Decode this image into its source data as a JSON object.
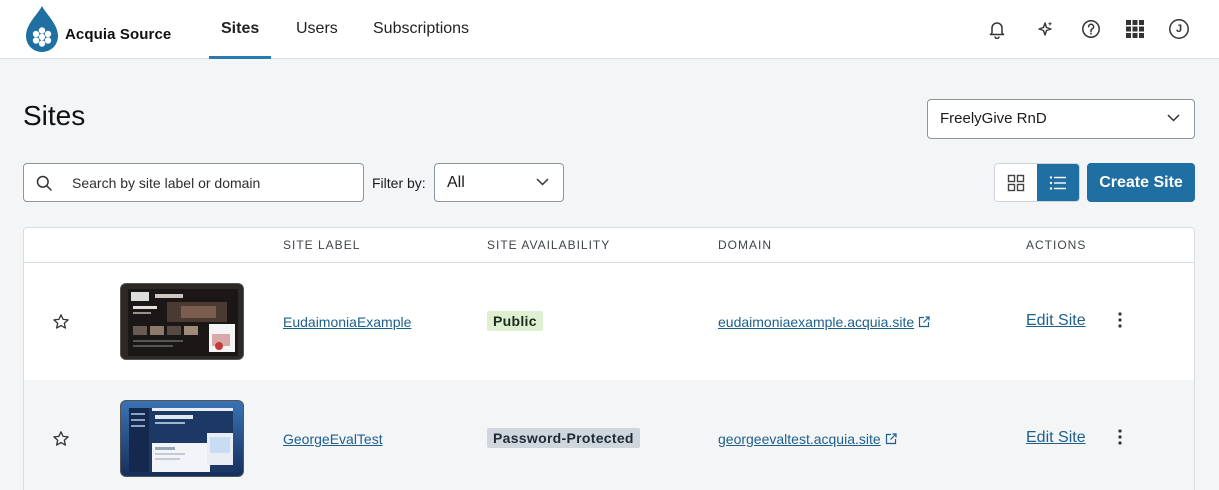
{
  "brand": {
    "name": "Acquia Source"
  },
  "nav": {
    "tabs": [
      {
        "label": "Sites",
        "active": true
      },
      {
        "label": "Users",
        "active": false
      },
      {
        "label": "Subscriptions",
        "active": false
      }
    ],
    "icons": [
      "bell-icon",
      "sparkle-icon",
      "help-icon",
      "apps-grid-icon",
      "user-avatar-icon"
    ],
    "avatar_initial": "J"
  },
  "page": {
    "title": "Sites"
  },
  "org_select": {
    "value": "FreelyGive RnD"
  },
  "toolbar": {
    "search_placeholder": "Search by site label or domain",
    "filter_label": "Filter by:",
    "filter_value": "All",
    "create_label": "Create Site",
    "view_mode": "list"
  },
  "table": {
    "headers": {
      "label": "SITE LABEL",
      "availability": "SITE AVAILABILITY",
      "domain": "DOMAIN",
      "actions": "ACTIONS"
    },
    "rows": [
      {
        "label": "EudaimoniaExample",
        "availability": "Public",
        "domain": "eudaimoniaexample.acquia.site",
        "edit": "Edit Site"
      },
      {
        "label": "GeorgeEvalTest",
        "availability": "Password-Protected",
        "domain": "georgeevaltest.acquia.site",
        "edit": "Edit Site"
      }
    ]
  },
  "colors": {
    "primary": "#1f6fa3",
    "link": "#1d5f8c",
    "public_badge": "#dff0d2",
    "protected_badge": "#cfd6de"
  }
}
